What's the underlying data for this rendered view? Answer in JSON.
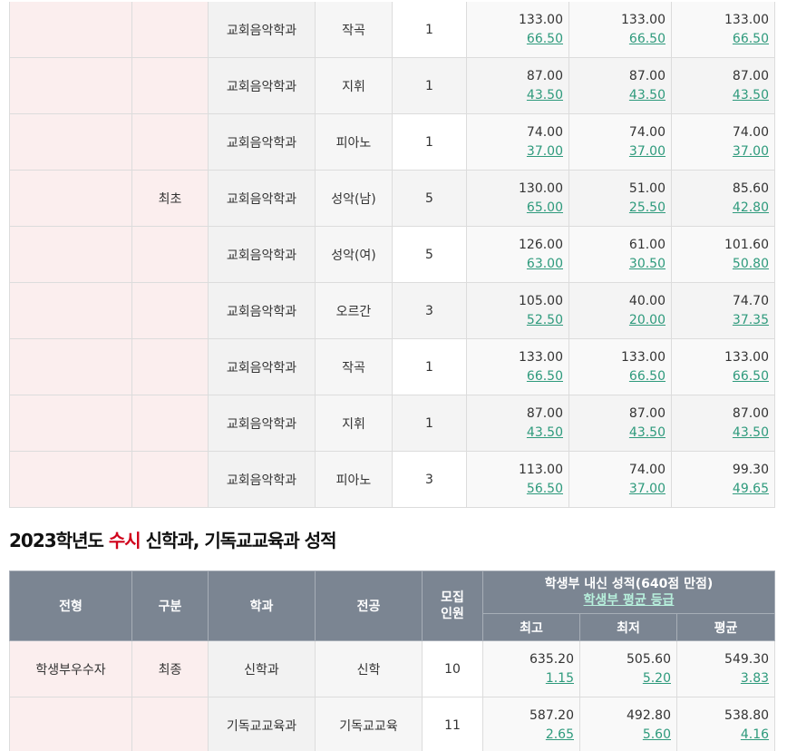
{
  "table1": {
    "rows": [
      {
        "type": "",
        "div": "",
        "dept": "교회음악학과",
        "major": "작곡",
        "count": "1",
        "max": "133.00",
        "max_g": "66.50",
        "min": "133.00",
        "min_g": "66.50",
        "avg": "133.00",
        "avg_g": "66.50"
      },
      {
        "type": "",
        "div": "",
        "dept": "교회음악학과",
        "major": "지휘",
        "count": "1",
        "max": "87.00",
        "max_g": "43.50",
        "min": "87.00",
        "min_g": "43.50",
        "avg": "87.00",
        "avg_g": "43.50"
      },
      {
        "type": "",
        "div": "",
        "dept": "교회음악학과",
        "major": "피아노",
        "count": "1",
        "max": "74.00",
        "max_g": "37.00",
        "min": "74.00",
        "min_g": "37.00",
        "avg": "74.00",
        "avg_g": "37.00"
      },
      {
        "type": "",
        "div": "최초",
        "dept": "교회음악학과",
        "major": "성악(남)",
        "count": "5",
        "max": "130.00",
        "max_g": "65.00",
        "min": "51.00",
        "min_g": "25.50",
        "avg": "85.60",
        "avg_g": "42.80"
      },
      {
        "type": "",
        "div": "",
        "dept": "교회음악학과",
        "major": "성악(여)",
        "count": "5",
        "max": "126.00",
        "max_g": "63.00",
        "min": "61.00",
        "min_g": "30.50",
        "avg": "101.60",
        "avg_g": "50.80"
      },
      {
        "type": "",
        "div": "",
        "dept": "교회음악학과",
        "major": "오르간",
        "count": "3",
        "max": "105.00",
        "max_g": "52.50",
        "min": "40.00",
        "min_g": "20.00",
        "avg": "74.70",
        "avg_g": "37.35"
      },
      {
        "type": "",
        "div": "",
        "dept": "교회음악학과",
        "major": "작곡",
        "count": "1",
        "max": "133.00",
        "max_g": "66.50",
        "min": "133.00",
        "min_g": "66.50",
        "avg": "133.00",
        "avg_g": "66.50"
      },
      {
        "type": "",
        "div": "",
        "dept": "교회음악학과",
        "major": "지휘",
        "count": "1",
        "max": "87.00",
        "max_g": "43.50",
        "min": "87.00",
        "min_g": "43.50",
        "avg": "87.00",
        "avg_g": "43.50"
      },
      {
        "type": "",
        "div": "",
        "dept": "교회음악학과",
        "major": "피아노",
        "count": "3",
        "max": "113.00",
        "max_g": "56.50",
        "min": "74.00",
        "min_g": "37.00",
        "avg": "99.30",
        "avg_g": "49.65"
      }
    ]
  },
  "section2": {
    "title_prefix": "2023학년도 ",
    "title_accent": "수시",
    "title_suffix": " 신학과, 기독교교육과 성적"
  },
  "table2": {
    "headers": {
      "type": "전형",
      "div": "구분",
      "dept": "학과",
      "major": "전공",
      "count_line1": "모집",
      "count_line2": "인원",
      "score_group": "학생부 내신 성적(640점 만점)",
      "score_link": "학생부 평균 등급",
      "max": "최고",
      "min": "최저",
      "avg": "평균"
    },
    "rows": [
      {
        "type": "학생부우수자",
        "div": "최종",
        "dept": "신학과",
        "major": "신학",
        "count": "10",
        "max": "635.20",
        "max_g": "1.15",
        "min": "505.60",
        "min_g": "5.20",
        "avg": "549.30",
        "avg_g": "3.83"
      },
      {
        "type": "",
        "div": "",
        "dept": "기독교교육과",
        "major": "기독교교육",
        "count": "11",
        "max": "587.20",
        "max_g": "2.65",
        "min": "492.80",
        "min_g": "5.60",
        "avg": "538.80",
        "avg_g": "4.16"
      }
    ]
  },
  "colors": {
    "accent_red": "#d0021b",
    "grade_green": "#2e9a7c",
    "header_bg": "#7b8592",
    "type_col_bg": "#fbeeee"
  }
}
